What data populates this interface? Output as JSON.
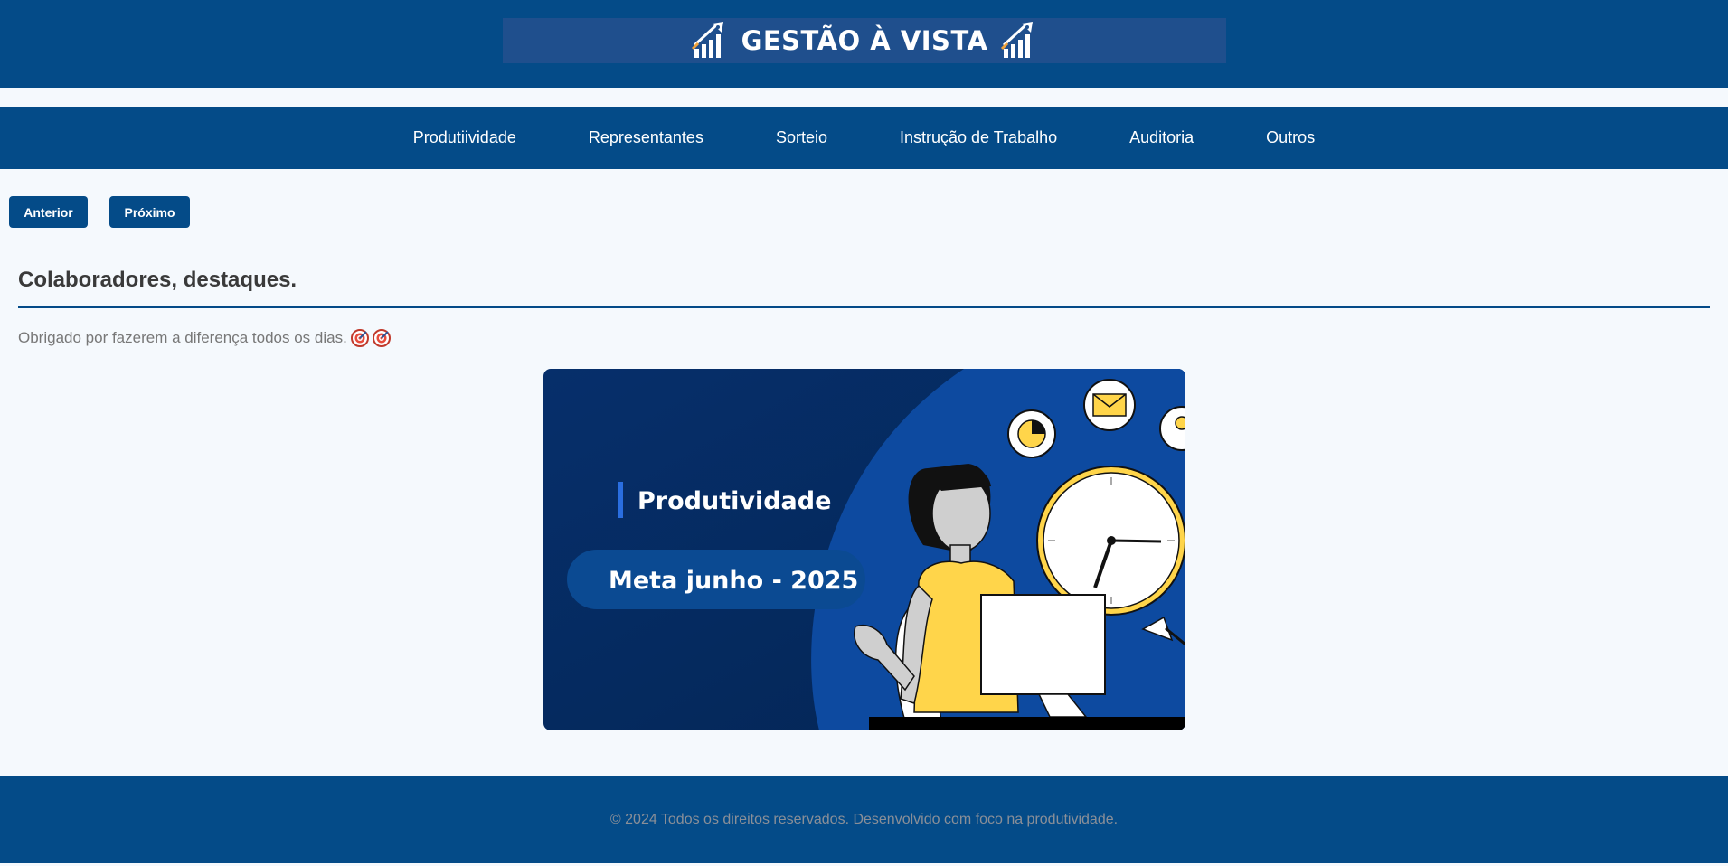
{
  "header": {
    "title": "GESTÃO À VISTA",
    "icon_left": "rocket-chart-icon",
    "icon_right": "rocket-chart-icon",
    "bg_color": "#044b88"
  },
  "nav": {
    "items": [
      {
        "label": "Produtiividade"
      },
      {
        "label": "Representantes"
      },
      {
        "label": "Sorteio"
      },
      {
        "label": "Instrução de Trabalho"
      },
      {
        "label": "Auditoria"
      },
      {
        "label": "Outros"
      }
    ]
  },
  "controls": {
    "prev_label": "Anterior",
    "next_label": "Próximo"
  },
  "main": {
    "title": "Colaboradores, destaques.",
    "subtitle": "Obrigado por fazerem a diferença todos os dias.",
    "subtitle_icons": [
      "target-icon",
      "target-icon"
    ]
  },
  "banner": {
    "heading": "Produtividade",
    "tagline": "Meta junho - 2025",
    "accent_color": "#ffd54a"
  },
  "footer": {
    "text": "© 2024 Todos os direitos reservados. Desenvolvido com foco na produtividade."
  }
}
